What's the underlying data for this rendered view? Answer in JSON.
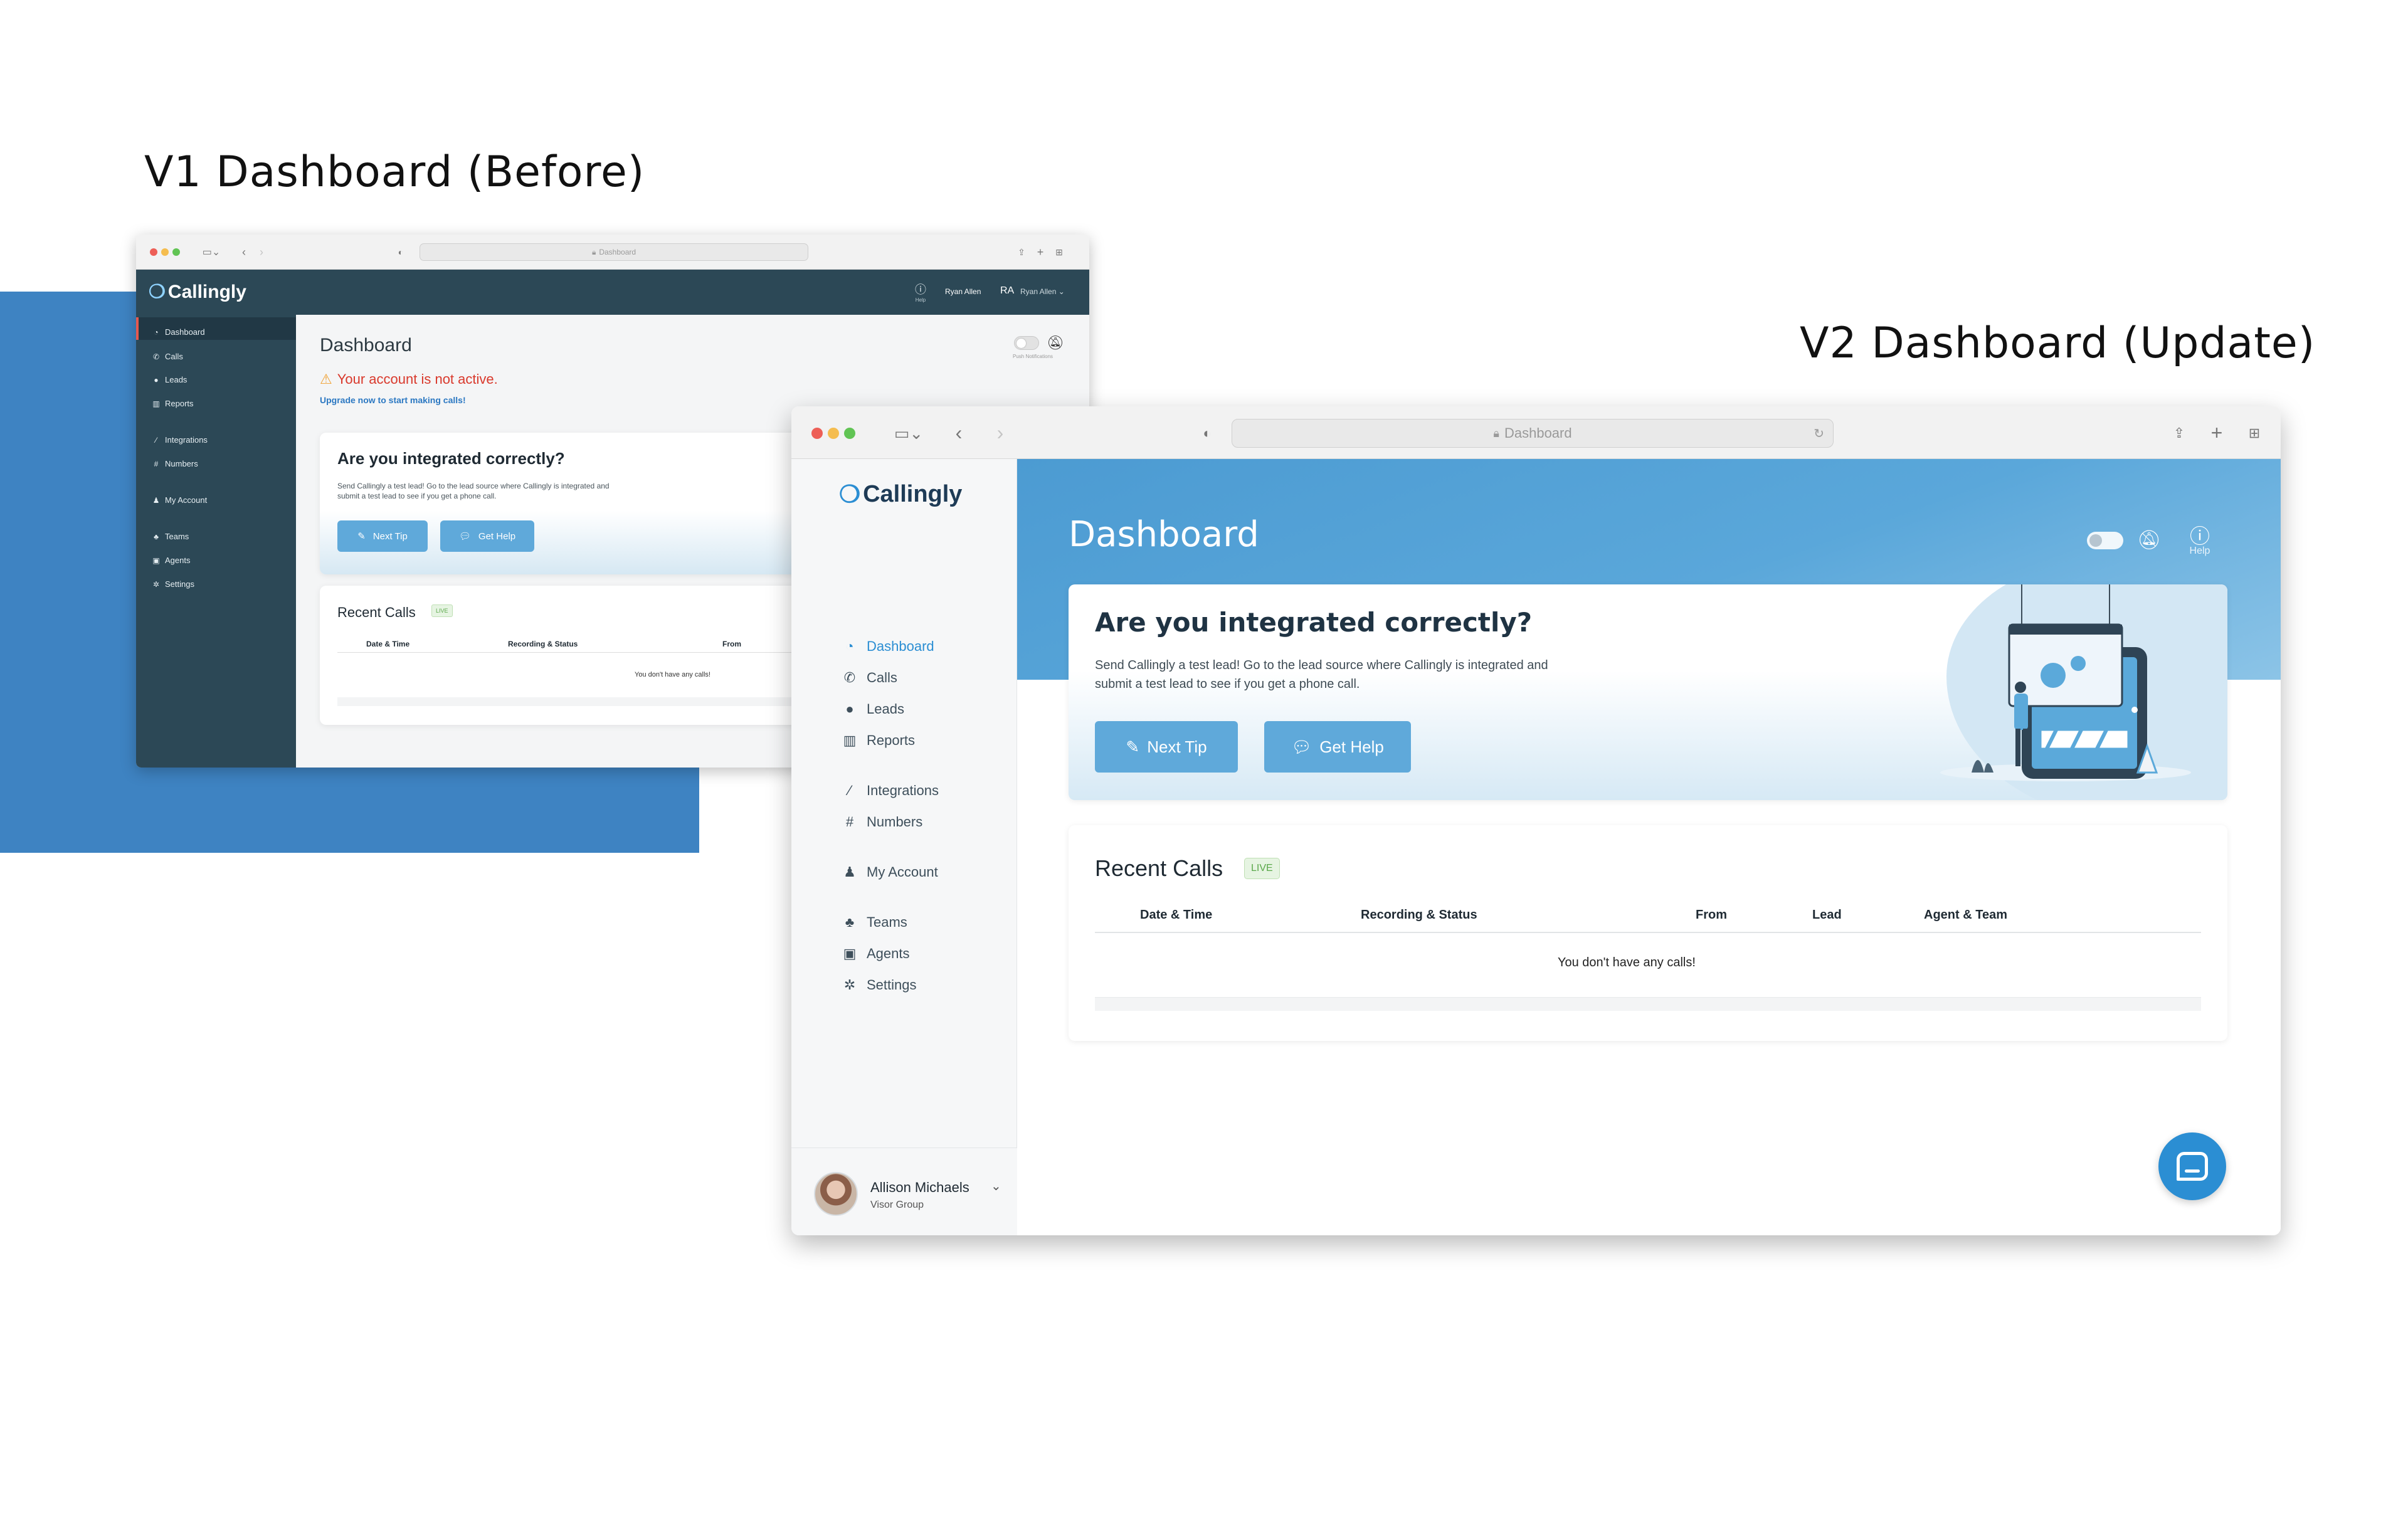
{
  "headings": {
    "v1": "V1 Dashboard (Before)",
    "v2": "V2 Dashboard (Update)"
  },
  "colors": {
    "brand_blue": "#3e83c2",
    "v1_nav_bg": "#2c4856",
    "v2_header_blue": "#4b98cf",
    "button_blue": "#5fa9da",
    "warning_red": "#d9392c",
    "live_green": "#5aa84a"
  },
  "v1": {
    "browser": {
      "url": "Dashboard"
    },
    "brand": "Callingly",
    "topbar": {
      "help": "Help",
      "user_name": "Ryan Allen",
      "initials": "RA",
      "user_menu": "Ryan Allen"
    },
    "sidebar": [
      {
        "label": "Dashboard",
        "icon": "dashboard-icon"
      },
      {
        "label": "Calls",
        "icon": "phone-icon"
      },
      {
        "label": "Leads",
        "icon": "user-circle-icon"
      },
      {
        "label": "Reports",
        "icon": "bar-chart-icon"
      },
      {
        "label": "Integrations",
        "icon": "wand-icon"
      },
      {
        "label": "Numbers",
        "icon": "hash-icon"
      },
      {
        "label": "My Account",
        "icon": "user-icon"
      },
      {
        "label": "Teams",
        "icon": "users-icon"
      },
      {
        "label": "Agents",
        "icon": "id-badge-icon"
      },
      {
        "label": "Settings",
        "icon": "gear-icon"
      }
    ],
    "page_title": "Dashboard",
    "push_label": "Push Notifications",
    "alert": {
      "title": "Your account is not active.",
      "link": "Upgrade now to start making calls!"
    },
    "integrated": {
      "title": "Are you integrated correctly?",
      "body1": "Send Callingly a test lead! Go to the lead source where Callingly is integrated and",
      "body2": "submit a test lead to see if you get a phone call.",
      "next_tip": "Next Tip",
      "get_help": "Get Help"
    },
    "recent": {
      "title": "Recent Calls",
      "badge": "LIVE",
      "columns": [
        "Date & Time",
        "Recording & Status",
        "From"
      ],
      "empty": "You don't have any calls!"
    }
  },
  "v2": {
    "browser": {
      "url": "Dashboard"
    },
    "brand": "Callingly",
    "sidebar": [
      {
        "label": "Dashboard",
        "icon": "dashboard-icon"
      },
      {
        "label": "Calls",
        "icon": "phone-icon"
      },
      {
        "label": "Leads",
        "icon": "user-circle-icon"
      },
      {
        "label": "Reports",
        "icon": "bar-chart-icon"
      },
      {
        "label": "Integrations",
        "icon": "wand-icon"
      },
      {
        "label": "Numbers",
        "icon": "hash-icon"
      },
      {
        "label": "My Account",
        "icon": "user-icon"
      },
      {
        "label": "Teams",
        "icon": "users-icon"
      },
      {
        "label": "Agents",
        "icon": "id-badge-icon"
      },
      {
        "label": "Settings",
        "icon": "gear-icon"
      }
    ],
    "user": {
      "name": "Allison Michaels",
      "company": "Visor Group"
    },
    "page_title": "Dashboard",
    "help": "Help",
    "integrated": {
      "title": "Are you integrated correctly?",
      "body1": "Send Callingly a test lead! Go to the lead source where Callingly is integrated and",
      "body2": "submit a test lead to see if you get a phone call.",
      "next_tip": "Next Tip",
      "get_help": "Get Help"
    },
    "recent": {
      "title": "Recent Calls",
      "badge": "LIVE",
      "columns": [
        "Date & Time",
        "Recording & Status",
        "From",
        "Lead",
        "Agent & Team"
      ],
      "empty": "You don't have any calls!"
    }
  }
}
